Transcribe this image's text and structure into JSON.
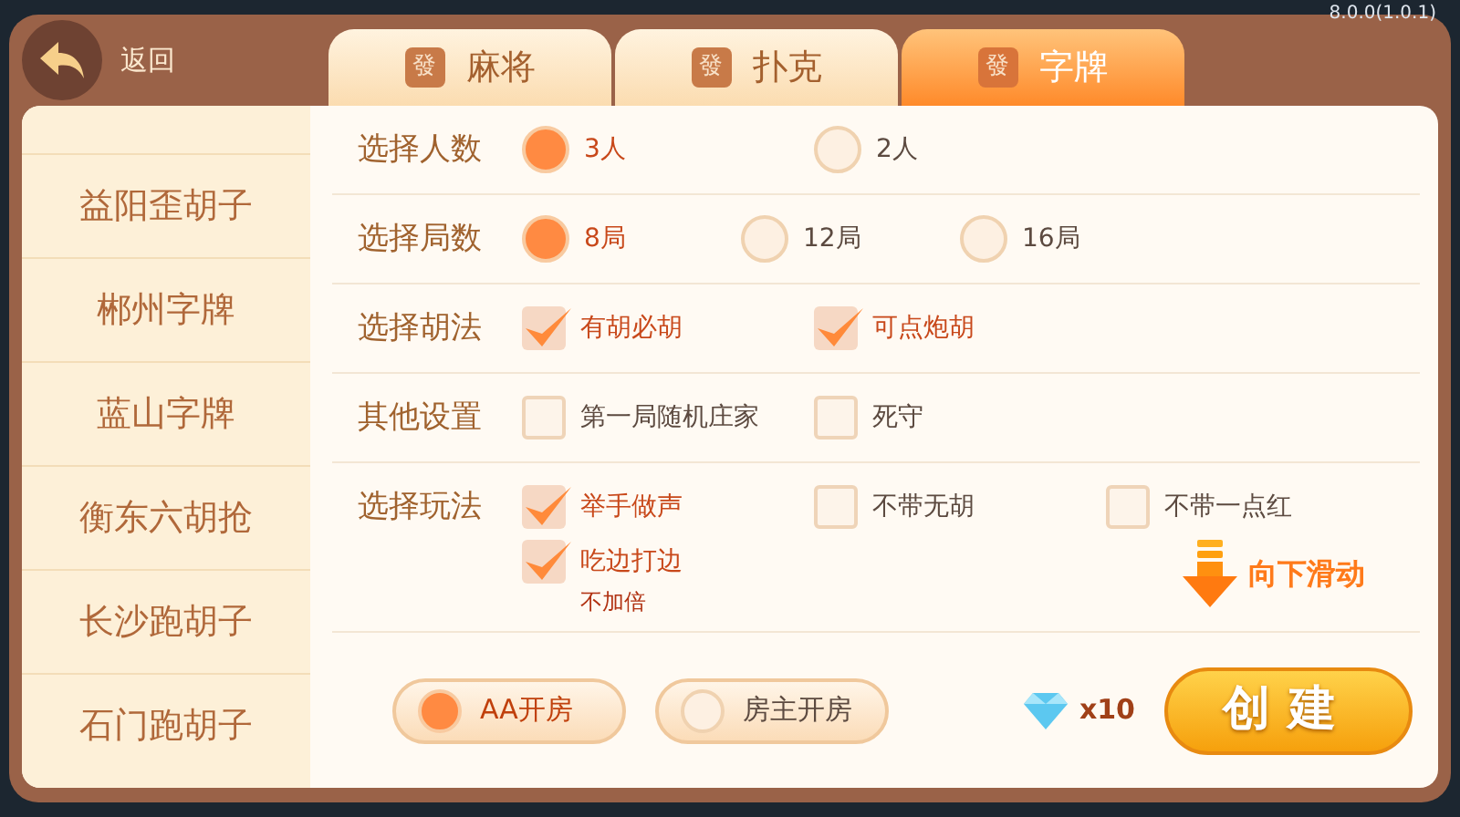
{
  "version": "8.0.0(1.0.1)",
  "back": {
    "label": "返回"
  },
  "tabs": [
    {
      "tile": "發",
      "label": "麻将",
      "selected": false
    },
    {
      "tile": "發",
      "label": "扑克",
      "selected": false
    },
    {
      "tile": "發",
      "label": "字牌",
      "selected": true
    }
  ],
  "sidebar": {
    "items": [
      {
        "label": "益阳歪胡子"
      },
      {
        "label": "郴州字牌"
      },
      {
        "label": "蓝山字牌"
      },
      {
        "label": "衡东六胡抢"
      },
      {
        "label": "长沙跑胡子"
      },
      {
        "label": "石门跑胡子"
      }
    ]
  },
  "options": [
    {
      "label": "选择人数",
      "kind": "radio",
      "choices": [
        {
          "label": "3人",
          "selected": true
        },
        {
          "label": "2人",
          "selected": false
        }
      ]
    },
    {
      "label": "选择局数",
      "kind": "radio",
      "choices": [
        {
          "label": "8局",
          "selected": true
        },
        {
          "label": "12局",
          "selected": false
        },
        {
          "label": "16局",
          "selected": false
        }
      ]
    },
    {
      "label": "选择胡法",
      "kind": "checkbox",
      "choices": [
        {
          "label": "有胡必胡",
          "checked": true
        },
        {
          "label": "可点炮胡",
          "checked": true
        }
      ]
    },
    {
      "label": "其他设置",
      "kind": "checkbox",
      "choices": [
        {
          "label": "第一局随机庄家",
          "checked": false
        },
        {
          "label": "死守",
          "checked": false
        }
      ]
    },
    {
      "label": "选择玩法",
      "kind": "checkbox",
      "choices": [
        {
          "label": "举手做声",
          "checked": true
        },
        {
          "label": "不带无胡",
          "checked": false
        },
        {
          "label": "不带一点红",
          "checked": false
        },
        {
          "label": "吃边打边",
          "checked": true,
          "note": "不加倍"
        }
      ]
    }
  ],
  "scroll_hint": "向下滑动",
  "room_modes": [
    {
      "label": "AA开房",
      "selected": true
    },
    {
      "label": "房主开房",
      "selected": false
    }
  ],
  "cost": "x10",
  "create_button": "创建"
}
